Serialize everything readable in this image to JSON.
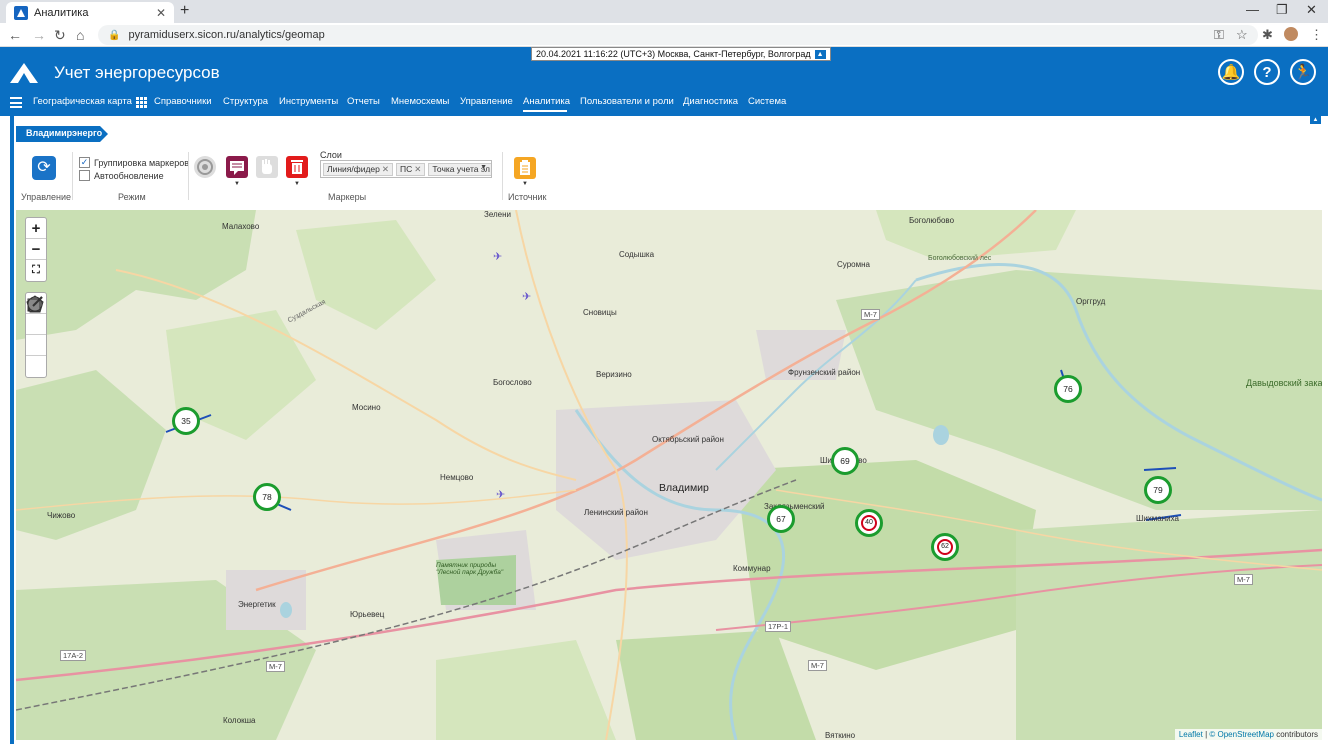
{
  "browser": {
    "tab_title": "Аналитика",
    "url": "pyramiduserx.sicon.ru/analytics/geomap"
  },
  "app": {
    "title": "Учет энергоресурсов",
    "datetime": "20.04.2021 11:16:22 (UTC+3) Москва, Санкт-Петербург, Волгоград"
  },
  "menu": [
    {
      "label": "Географическая карта"
    },
    {
      "label": "Справочники"
    },
    {
      "label": "Структура"
    },
    {
      "label": "Инструменты"
    },
    {
      "label": "Отчеты"
    },
    {
      "label": "Мнемосхемы"
    },
    {
      "label": "Управление"
    },
    {
      "label": "Аналитика"
    },
    {
      "label": "Пользователи и роли"
    },
    {
      "label": "Диагностика"
    },
    {
      "label": "Система"
    }
  ],
  "breadcrumb": "Владимирэнерго",
  "toolbar": {
    "group_control": "Управление",
    "group_mode": "Режим",
    "group_markers": "Маркеры",
    "group_source": "Источник",
    "chk_grouping": "Группировка маркеров",
    "chk_grouping_checked": true,
    "chk_autorefresh": "Автообновление",
    "chk_autorefresh_checked": false,
    "layers_label": "Слои",
    "layers": [
      "Линия/фидер",
      "ПС",
      "Точка учета эл"
    ]
  },
  "map": {
    "places": [
      "Зелени",
      "Малахово",
      "Боголюбово",
      "Содышка",
      "Суромна",
      "Боголюбовский лес",
      "Сновицы",
      "Орггруд",
      "Веризино",
      "Фрунзенский район",
      "Богослово",
      "Давыдовский заказник",
      "Мосино",
      "Октябрьский район",
      "Владимир",
      "Немцово",
      "Ленинский район",
      "Чижово",
      "Заклязьменский",
      "Коммунар",
      "Шихобалово",
      "Энергетик",
      "Юрьевец",
      "Памятник природы \"Лесной парк Дружба\"",
      "Колокша",
      "Вяткино",
      "Шихманиха",
      "Суздальская"
    ],
    "roads": [
      "М-7",
      "М-7",
      "М-7",
      "М-7",
      "17Р-1",
      "17А-2"
    ],
    "clusters": [
      {
        "label": "35"
      },
      {
        "label": "78"
      },
      {
        "label": "69"
      },
      {
        "label": "67"
      },
      {
        "label": "76"
      },
      {
        "label": "79"
      }
    ],
    "alarms": [
      {
        "label": "40"
      },
      {
        "label": "62"
      }
    ],
    "attribution_leaflet": "Leaflet",
    "attribution_osm": "© OpenStreetMap",
    "attribution_suffix": "contributors"
  },
  "colors": {
    "brand": "#0a6fc2",
    "cluster_ring": "#1b9c2e",
    "alarm_ring": "#d0021b"
  }
}
